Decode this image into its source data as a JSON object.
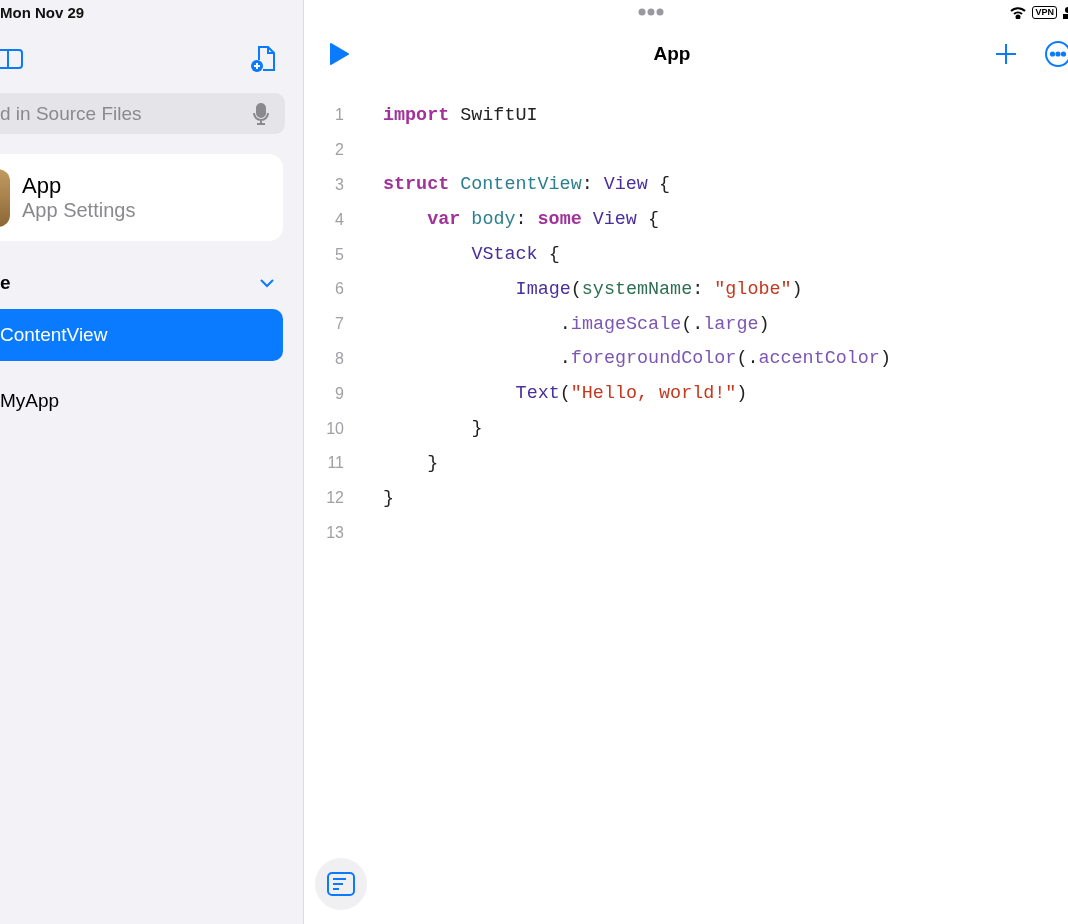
{
  "status_bar": {
    "date": "Mon Nov 29",
    "vpn": "VPN"
  },
  "sidebar": {
    "search": {
      "placeholder": "d in Source Files"
    },
    "project": {
      "name": "App",
      "subtitle": "App Settings"
    },
    "section": {
      "title": "e",
      "expanded": true
    },
    "files": [
      {
        "name": "ContentView",
        "selected": true
      },
      {
        "name": "MyApp",
        "selected": false
      }
    ]
  },
  "editor": {
    "title": "App",
    "lines": [
      {
        "number": "1",
        "tokens": [
          {
            "kind": "keyword",
            "text": "import "
          },
          {
            "kind": "plain",
            "text": "SwiftUI"
          }
        ]
      },
      {
        "number": "2"
      },
      {
        "number": "3",
        "tokens": [
          {
            "kind": "keyword",
            "text": "struct "
          },
          {
            "kind": "decl",
            "text": "ContentView"
          },
          {
            "kind": "plain",
            "text": ": "
          },
          {
            "kind": "type",
            "text": "View"
          },
          {
            "kind": "plain",
            "text": " {"
          }
        ],
        "children": [
          {
            "number": "4",
            "tokens": [
              {
                "kind": "keyword",
                "text": "var "
              },
              {
                "kind": "decl",
                "text": "body"
              },
              {
                "kind": "plain",
                "text": ": "
              },
              {
                "kind": "keyword",
                "text": "some "
              },
              {
                "kind": "type",
                "text": "View"
              },
              {
                "kind": "plain",
                "text": " {"
              }
            ],
            "children": [
              {
                "number": "5",
                "tokens": [
                  {
                    "kind": "type",
                    "text": "VStack"
                  },
                  {
                    "kind": "plain",
                    "text": " {"
                  }
                ],
                "children": [
                  {
                    "number": "6",
                    "tokens": [
                      {
                        "kind": "type",
                        "text": "Image"
                      },
                      {
                        "kind": "plain",
                        "text": "("
                      },
                      {
                        "kind": "param",
                        "text": "systemName"
                      },
                      {
                        "kind": "plain",
                        "text": ": "
                      },
                      {
                        "kind": "string",
                        "text": "\"globe\""
                      },
                      {
                        "kind": "plain",
                        "text": ")"
                      }
                    ],
                    "children": [
                      {
                        "number": "7",
                        "tokens": [
                          {
                            "kind": "plain",
                            "text": "."
                          },
                          {
                            "kind": "member",
                            "text": "imageScale"
                          },
                          {
                            "kind": "plain",
                            "text": "(."
                          },
                          {
                            "kind": "member",
                            "text": "large"
                          },
                          {
                            "kind": "plain",
                            "text": ")"
                          }
                        ]
                      },
                      {
                        "number": "8",
                        "tokens": [
                          {
                            "kind": "plain",
                            "text": "."
                          },
                          {
                            "kind": "member",
                            "text": "foregroundColor"
                          },
                          {
                            "kind": "plain",
                            "text": "(."
                          },
                          {
                            "kind": "member",
                            "text": "accentColor"
                          },
                          {
                            "kind": "plain",
                            "text": ")"
                          }
                        ]
                      }
                    ]
                  },
                  {
                    "number": "9",
                    "tokens": [
                      {
                        "kind": "type",
                        "text": "Text"
                      },
                      {
                        "kind": "plain",
                        "text": "("
                      },
                      {
                        "kind": "string",
                        "text": "\"Hello, world!\""
                      },
                      {
                        "kind": "plain",
                        "text": ")"
                      }
                    ]
                  }
                ]
              },
              {
                "number": "10",
                "tokens": [
                  {
                    "kind": "plain",
                    "text": "}"
                  }
                ]
              }
            ]
          },
          {
            "number": "11",
            "tokens": [
              {
                "kind": "plain",
                "text": "}"
              }
            ]
          }
        ]
      },
      {
        "number": "12",
        "tokens": [
          {
            "kind": "plain",
            "text": "}"
          }
        ]
      },
      {
        "number": "13"
      }
    ]
  }
}
